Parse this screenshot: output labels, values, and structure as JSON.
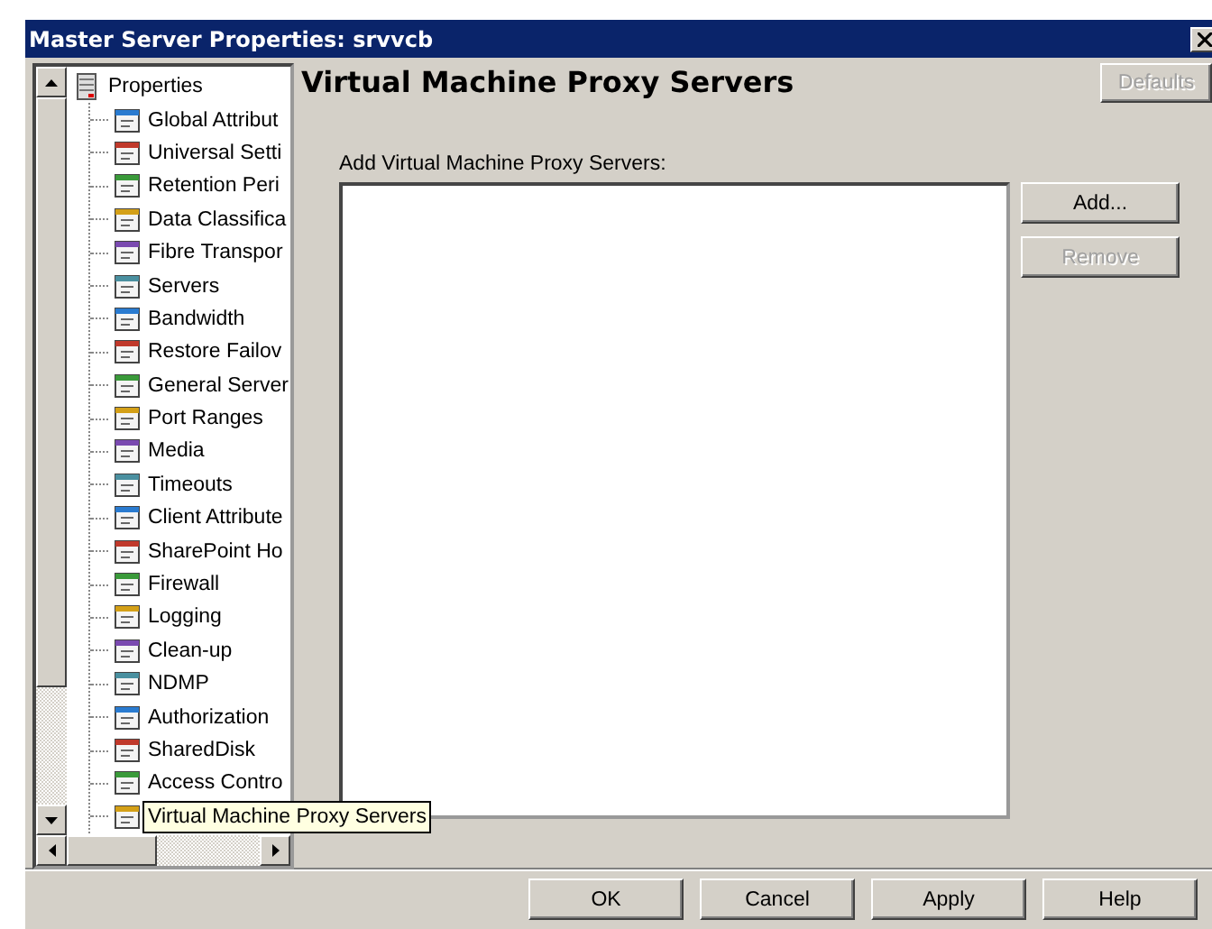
{
  "window": {
    "title": "Master Server Properties: srvvcb"
  },
  "tree": {
    "label": "Properties",
    "expanded": true,
    "children": [
      {
        "label": "Global Attribut"
      },
      {
        "label": "Universal Setti"
      },
      {
        "label": "Retention Peri"
      },
      {
        "label": "Data Classifica"
      },
      {
        "label": "Fibre Transpor"
      },
      {
        "label": "Servers"
      },
      {
        "label": "Bandwidth"
      },
      {
        "label": "Restore Failov"
      },
      {
        "label": "General Server"
      },
      {
        "label": "Port Ranges"
      },
      {
        "label": "Media"
      },
      {
        "label": "Timeouts"
      },
      {
        "label": "Client Attribute"
      },
      {
        "label": "SharePoint Ho"
      },
      {
        "label": "Firewall"
      },
      {
        "label": "Logging"
      },
      {
        "label": "Clean-up"
      },
      {
        "label": "NDMP"
      },
      {
        "label": "Authorization"
      },
      {
        "label": "SharedDisk"
      },
      {
        "label": "Access Contro"
      },
      {
        "tooltip": "Virtual Machine Proxy Servers"
      }
    ]
  },
  "panel": {
    "title": "Virtual Machine Proxy Servers",
    "defaults_button": {
      "label": "Defaults",
      "disabled": true
    },
    "list_label": "Add Virtual Machine Proxy Servers:",
    "side_buttons": [
      {
        "label": "Add...",
        "disabled": false
      },
      {
        "label": "Remove",
        "disabled": true
      }
    ]
  },
  "buttons": [
    {
      "label": "OK"
    },
    {
      "label": "Cancel"
    },
    {
      "label": "Apply"
    },
    {
      "label": "Help"
    }
  ]
}
